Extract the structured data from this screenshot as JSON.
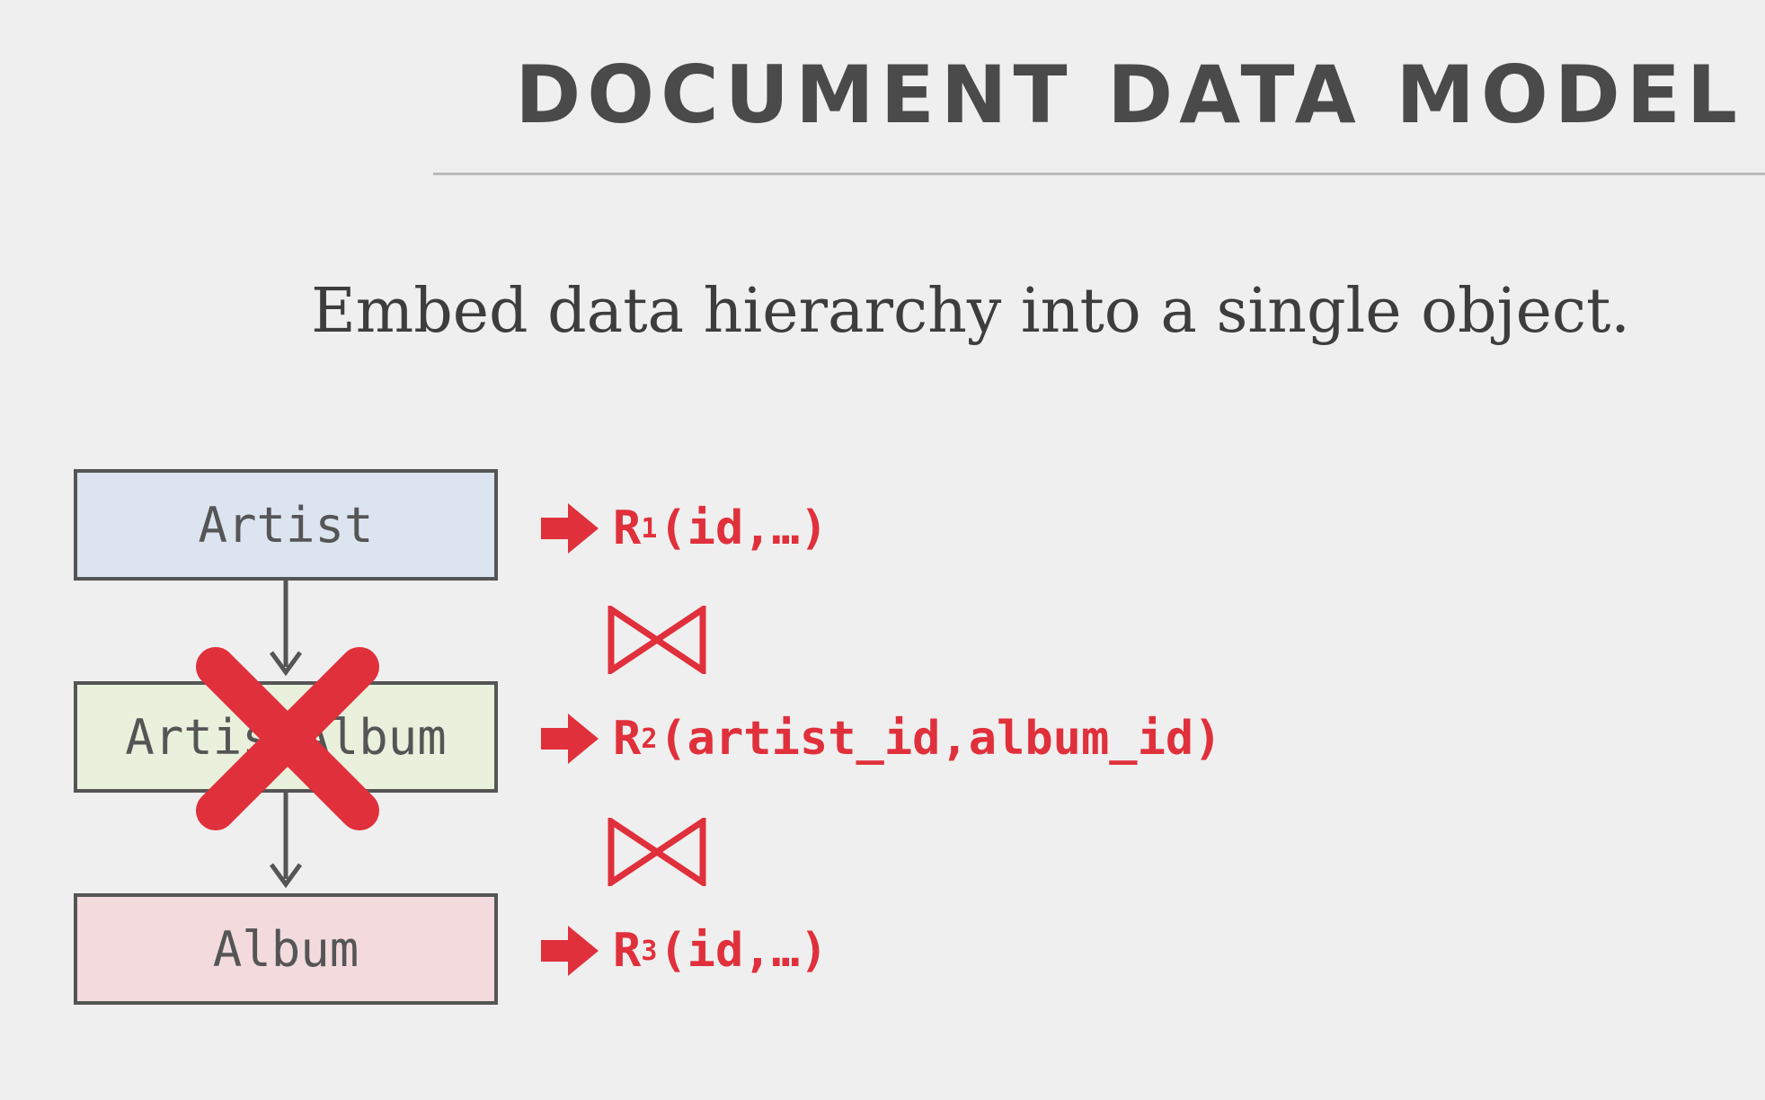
{
  "slide": {
    "title": "DOCUMENT DATA MODEL",
    "subtitle": "Embed data hierarchy into a single object."
  },
  "entities": [
    {
      "label": "Artist",
      "fill": "#dbe4ef"
    },
    {
      "label": "ArtistAlbum",
      "fill": "#e9f0dc",
      "crossed_out": true
    },
    {
      "label": "Album",
      "fill": "#f2dadd"
    }
  ],
  "relations": [
    {
      "name": "R",
      "subscript": "1",
      "args": "(id,…)"
    },
    {
      "name": "R",
      "subscript": "2",
      "args": "(artist_id,album_id)"
    },
    {
      "name": "R",
      "subscript": "3",
      "args": "(id,…)"
    }
  ],
  "colors": {
    "accent_red": "#e0303b",
    "title_gray": "#4a4a4a",
    "box_border": "#555555",
    "background": "#efefef"
  },
  "icons": [
    "right-arrow-icon",
    "join-bowtie-icon",
    "cross-out-icon",
    "down-arrow-icon"
  ]
}
